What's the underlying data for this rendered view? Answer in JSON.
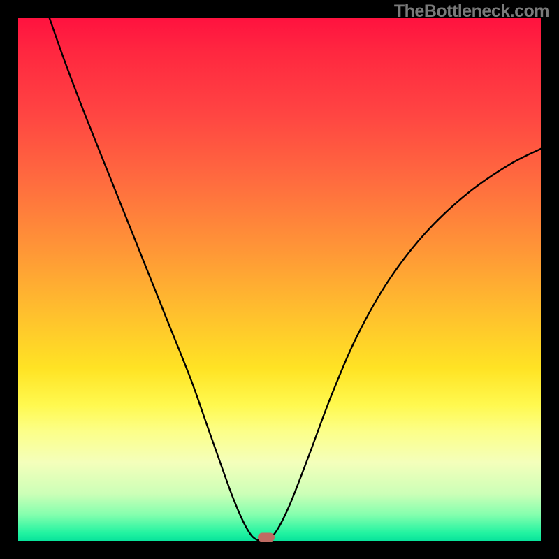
{
  "watermark_text": "TheBottleneck.com",
  "chart_data": {
    "type": "line",
    "title": "",
    "xlabel": "",
    "ylabel": "",
    "x_range_fraction": [
      0,
      1
    ],
    "y_range_percent": [
      0,
      100
    ],
    "curve_points_fraction": [
      {
        "x": 0.06,
        "y": 1.0
      },
      {
        "x": 0.09,
        "y": 0.915
      },
      {
        "x": 0.13,
        "y": 0.81
      },
      {
        "x": 0.17,
        "y": 0.71
      },
      {
        "x": 0.21,
        "y": 0.61
      },
      {
        "x": 0.25,
        "y": 0.51
      },
      {
        "x": 0.29,
        "y": 0.41
      },
      {
        "x": 0.33,
        "y": 0.31
      },
      {
        "x": 0.36,
        "y": 0.225
      },
      {
        "x": 0.39,
        "y": 0.14
      },
      {
        "x": 0.41,
        "y": 0.085
      },
      {
        "x": 0.43,
        "y": 0.038
      },
      {
        "x": 0.445,
        "y": 0.012
      },
      {
        "x": 0.455,
        "y": 0.003
      },
      {
        "x": 0.465,
        "y": 0.0
      },
      {
        "x": 0.478,
        "y": 0.003
      },
      {
        "x": 0.495,
        "y": 0.02
      },
      {
        "x": 0.52,
        "y": 0.07
      },
      {
        "x": 0.555,
        "y": 0.16
      },
      {
        "x": 0.6,
        "y": 0.28
      },
      {
        "x": 0.65,
        "y": 0.395
      },
      {
        "x": 0.71,
        "y": 0.5
      },
      {
        "x": 0.78,
        "y": 0.59
      },
      {
        "x": 0.86,
        "y": 0.665
      },
      {
        "x": 0.94,
        "y": 0.72
      },
      {
        "x": 1.0,
        "y": 0.75
      }
    ],
    "vertex_fraction": {
      "x": 0.465,
      "y": 0.0
    },
    "marker": {
      "x_fraction": 0.475,
      "y_fraction": 0.007,
      "color_hex": "#bf6b63"
    },
    "gradient_stops": [
      {
        "pos": 0.0,
        "hex": "#ff123f"
      },
      {
        "pos": 0.06,
        "hex": "#ff2640"
      },
      {
        "pos": 0.18,
        "hex": "#ff4442"
      },
      {
        "pos": 0.31,
        "hex": "#ff6b3f"
      },
      {
        "pos": 0.44,
        "hex": "#ff9537"
      },
      {
        "pos": 0.56,
        "hex": "#ffbe2e"
      },
      {
        "pos": 0.67,
        "hex": "#ffe324"
      },
      {
        "pos": 0.74,
        "hex": "#fff94f"
      },
      {
        "pos": 0.79,
        "hex": "#fcff88"
      },
      {
        "pos": 0.85,
        "hex": "#f4ffbb"
      },
      {
        "pos": 0.91,
        "hex": "#ccffb7"
      },
      {
        "pos": 0.95,
        "hex": "#84ffae"
      },
      {
        "pos": 0.985,
        "hex": "#22f3a1"
      },
      {
        "pos": 1.0,
        "hex": "#08e39b"
      }
    ]
  }
}
